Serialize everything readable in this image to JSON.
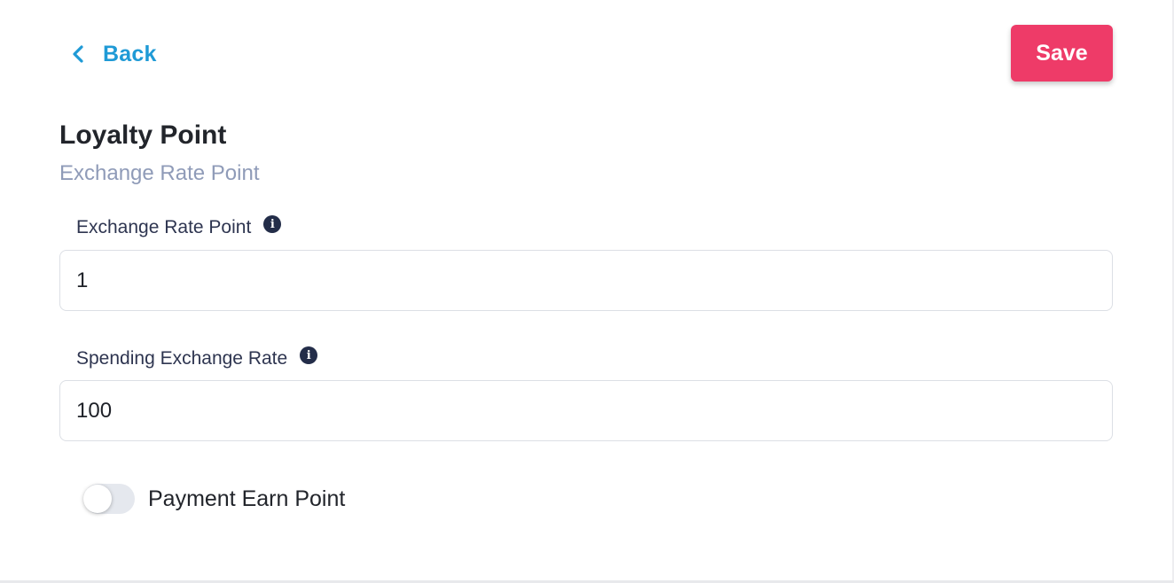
{
  "header": {
    "back_label": "Back",
    "save_label": "Save"
  },
  "page": {
    "title": "Loyalty Point",
    "subtitle": "Exchange Rate Point"
  },
  "form": {
    "exchange_rate_point": {
      "label": "Exchange Rate Point",
      "value": "1",
      "info_icon": "info-icon"
    },
    "spending_exchange_rate": {
      "label": "Spending Exchange Rate",
      "value": "100",
      "info_icon": "info-icon"
    },
    "payment_earn_point": {
      "label": "Payment Earn Point",
      "enabled": false
    }
  },
  "colors": {
    "accent_blue": "#1f9ad6",
    "save_button": "#ee3b68",
    "subtitle": "#8f9bb8",
    "info_icon": "#232d49"
  }
}
